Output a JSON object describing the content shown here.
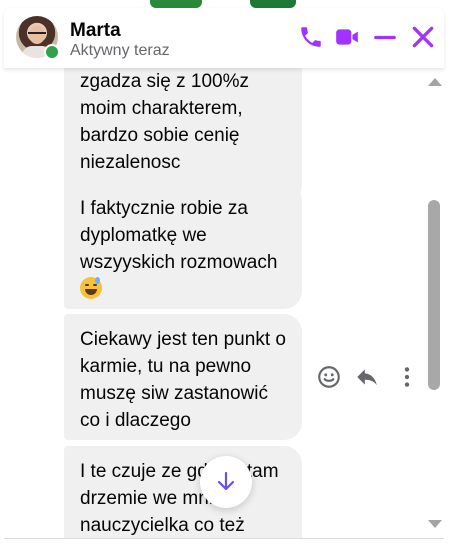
{
  "contact": {
    "name": "Marta",
    "status": "Aktywny teraz",
    "online": true
  },
  "header_icons": [
    "phone-icon",
    "video-icon",
    "minimize-icon",
    "close-icon"
  ],
  "accent_color": "#a033ff",
  "messages": [
    {
      "text": "zgadza się z 100%z moim charakterem, bardzo sobie cenię niezalenosc"
    },
    {
      "text": "I faktycznie robie za dyplomatkę we wszyyskich rozmowach"
    },
    {
      "text": "Ciekawy jest ten punkt o karmie, tu na pewno muszę siw zastanowić co i dlaczego"
    },
    {
      "text": "I te czuje ze gdzieś tam drzemie we mnie nauczycielka co też"
    }
  ],
  "message_actions": [
    "emoji-react-icon",
    "reply-icon",
    "more-options-icon"
  ],
  "jump_button_icon": "arrow-down-icon"
}
